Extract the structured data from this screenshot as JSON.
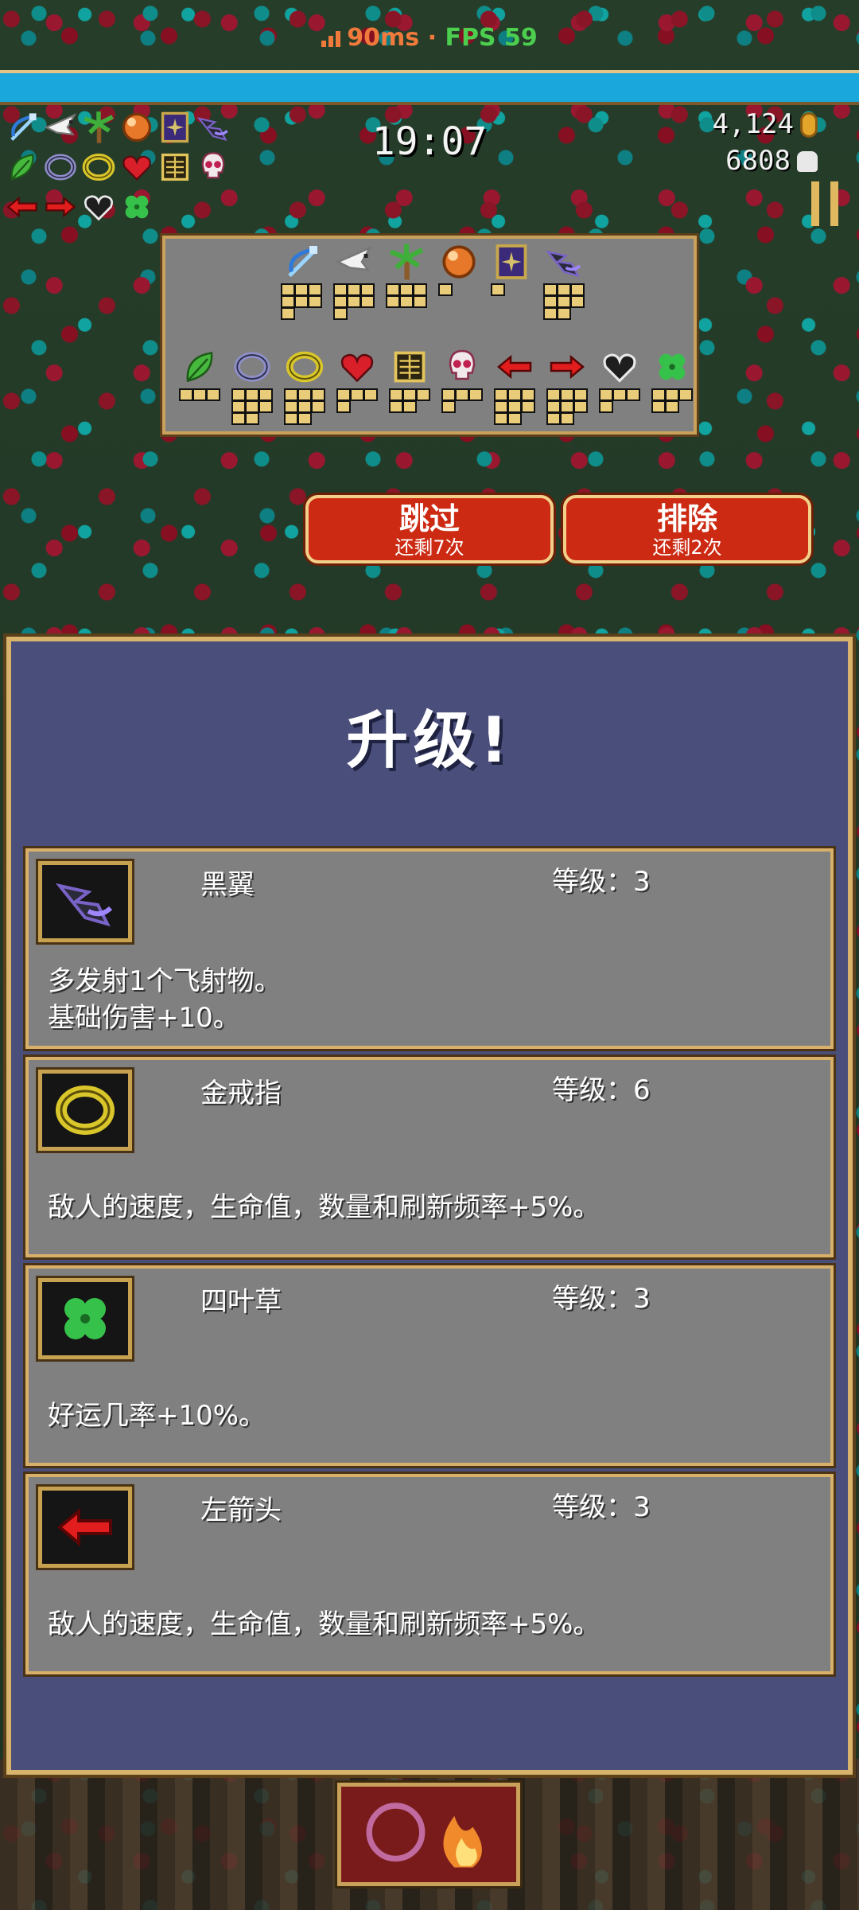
{
  "status_bar": {
    "ping": "90ms",
    "separator": "·",
    "fps": "FPS 59"
  },
  "hud": {
    "timer": "19:07",
    "gold": "4,124",
    "kills": "6808"
  },
  "hud_icons": [
    [
      "bow-icon",
      "dove-icon",
      "palm-icon",
      "orb-icon",
      "spellbook-icon",
      "black-wing-icon"
    ],
    [
      "leaf-icon",
      "silver-ring-icon",
      "gold-ring-icon",
      "heart-icon",
      "candelabra-icon",
      "skull-icon"
    ],
    [
      "left-arrow-icon",
      "right-arrow-icon",
      "black-heart-icon",
      "clover-icon"
    ]
  ],
  "inventory": {
    "weapons": [
      {
        "icon": "bow-icon",
        "pips": 7
      },
      {
        "icon": "dove-icon",
        "pips": 7
      },
      {
        "icon": "palm-icon",
        "pips": 6
      },
      {
        "icon": "orb-icon",
        "pips": 1
      },
      {
        "icon": "spellbook-icon",
        "pips": 1
      },
      {
        "icon": "black-wing-icon",
        "pips": 8
      }
    ],
    "passives": [
      {
        "icon": "leaf-icon",
        "pips": 3
      },
      {
        "icon": "silver-ring-icon",
        "pips": 8
      },
      {
        "icon": "gold-ring-icon",
        "pips": 8
      },
      {
        "icon": "heart-icon",
        "pips": 4
      },
      {
        "icon": "candelabra-icon",
        "pips": 5
      },
      {
        "icon": "skull-icon",
        "pips": 4
      },
      {
        "icon": "left-arrow-icon",
        "pips": 8
      },
      {
        "icon": "right-arrow-icon",
        "pips": 8
      },
      {
        "icon": "black-heart-icon",
        "pips": 4
      },
      {
        "icon": "clover-icon",
        "pips": 5
      }
    ]
  },
  "actions": {
    "skip": {
      "label": "跳过",
      "sub": "还剩7次"
    },
    "banish": {
      "label": "排除",
      "sub": "还剩2次"
    }
  },
  "levelup": {
    "title": "升级!",
    "options": [
      {
        "name": "黑翼",
        "level": "等级：3",
        "icon": "black-wing-icon",
        "desc_line1": "多发射1个飞射物。",
        "desc_line2": "基础伤害+10。"
      },
      {
        "name": "金戒指",
        "level": "等级：6",
        "icon": "gold-ring-icon",
        "desc_line1": "敌人的速度，生命值，数量和刷新频率+5%。",
        "desc_line2": ""
      },
      {
        "name": "四叶草",
        "level": "等级：3",
        "icon": "clover-icon",
        "desc_line1": "好运几率+10%。",
        "desc_line2": ""
      },
      {
        "name": "左箭头",
        "level": "等级：3",
        "icon": "left-arrow-icon",
        "desc_line1": "敌人的速度，生命值，数量和刷新频率+5%。",
        "desc_line2": ""
      }
    ]
  },
  "colors": {
    "panel": "#4a4e7a",
    "card": "#808080",
    "gold_border": "#d9b06a",
    "button": "#cc2a12",
    "xp": "#1aa8dc"
  }
}
